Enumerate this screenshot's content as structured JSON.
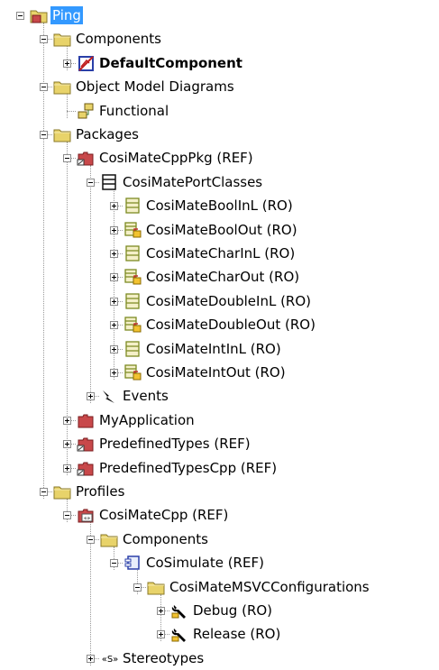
{
  "colors": {
    "selection": "#3399ff",
    "folder": "#e8d36a",
    "package": "#c8484a",
    "connector": "#9a9a9a"
  },
  "tree": [
    {
      "label": "Ping",
      "icon": "package-folder-icon",
      "toggle": "minus",
      "selected": true,
      "name": "tree-item-ping"
    },
    {
      "label": "Components",
      "icon": "folder-icon",
      "toggle": "minus",
      "name": "tree-item-components"
    },
    {
      "label": "DefaultComponent",
      "icon": "component-icon",
      "toggle": "plus",
      "bold": true,
      "name": "tree-item-defaultcomponent"
    },
    {
      "label": "Object Model Diagrams",
      "icon": "folder-icon",
      "toggle": "minus",
      "name": "tree-item-object-model-diagrams"
    },
    {
      "label": "Functional",
      "icon": "diagram-icon",
      "toggle": "none",
      "name": "tree-item-functional"
    },
    {
      "label": "Packages",
      "icon": "folder-icon",
      "toggle": "minus",
      "name": "tree-item-packages"
    },
    {
      "label": "CosiMateCppPkg (REF)",
      "icon": "package-ref-icon",
      "toggle": "minus",
      "name": "tree-item-cosimatecpppkg"
    },
    {
      "label": "CosiMatePortClasses",
      "icon": "class-folder-icon",
      "toggle": "minus",
      "name": "tree-item-cosimateportclasses"
    },
    {
      "label": "CosiMateBoolInL (RO)",
      "icon": "class-icon",
      "toggle": "plus",
      "name": "tree-item-cosimateboolinl"
    },
    {
      "label": "CosiMateBoolOut (RO)",
      "icon": "class-locked-icon",
      "toggle": "plus",
      "name": "tree-item-cosimatebooloout"
    },
    {
      "label": "CosiMateCharInL (RO)",
      "icon": "class-icon",
      "toggle": "plus",
      "name": "tree-item-cosimatecharinl"
    },
    {
      "label": "CosiMateCharOut (RO)",
      "icon": "class-locked-icon",
      "toggle": "plus",
      "name": "tree-item-cosimatecharout"
    },
    {
      "label": "CosiMateDoubleInL (RO)",
      "icon": "class-icon",
      "toggle": "plus",
      "name": "tree-item-cosimatedoubleinl"
    },
    {
      "label": "CosiMateDoubleOut (RO)",
      "icon": "class-locked-icon",
      "toggle": "plus",
      "name": "tree-item-cosimatedoubleout"
    },
    {
      "label": "CosiMateIntInL (RO)",
      "icon": "class-icon",
      "toggle": "plus",
      "name": "tree-item-cosimateintinl"
    },
    {
      "label": "CosiMateIntOut (RO)",
      "icon": "class-locked-icon",
      "toggle": "plus",
      "name": "tree-item-cosimateintout"
    },
    {
      "label": "Events",
      "icon": "event-icon",
      "toggle": "plus",
      "name": "tree-item-events"
    },
    {
      "label": "MyApplication",
      "icon": "package-icon",
      "toggle": "plus",
      "name": "tree-item-myapplication"
    },
    {
      "label": "PredefinedTypes (REF)",
      "icon": "package-ref-icon",
      "toggle": "plus",
      "name": "tree-item-predefinedtypes"
    },
    {
      "label": "PredefinedTypesCpp (REF)",
      "icon": "package-ref-icon",
      "toggle": "plus",
      "name": "tree-item-predefinedtypescpp"
    },
    {
      "label": "Profiles",
      "icon": "folder-icon",
      "toggle": "minus",
      "name": "tree-item-profiles"
    },
    {
      "label": "CosiMateCpp (REF)",
      "icon": "profile-icon",
      "toggle": "minus",
      "name": "tree-item-cosimatecpp"
    },
    {
      "label": "Components",
      "icon": "folder-icon",
      "toggle": "minus",
      "name": "tree-item-profile-components"
    },
    {
      "label": "CoSimulate (REF)",
      "icon": "component-small-icon",
      "toggle": "minus",
      "name": "tree-item-cosimulate"
    },
    {
      "label": "CosiMateMSVCConfigurations",
      "icon": "folder-icon",
      "toggle": "minus",
      "name": "tree-item-cosimatemsvcconfigurations"
    },
    {
      "label": "Debug (RO)",
      "icon": "wrench-icon",
      "toggle": "plus",
      "name": "tree-item-debug"
    },
    {
      "label": "Release (RO)",
      "icon": "wrench-icon",
      "toggle": "plus",
      "name": "tree-item-release"
    },
    {
      "label": "Stereotypes",
      "icon": "stereotype-icon",
      "icon_text": "«S»",
      "toggle": "plus",
      "name": "tree-item-stereotypes"
    }
  ]
}
